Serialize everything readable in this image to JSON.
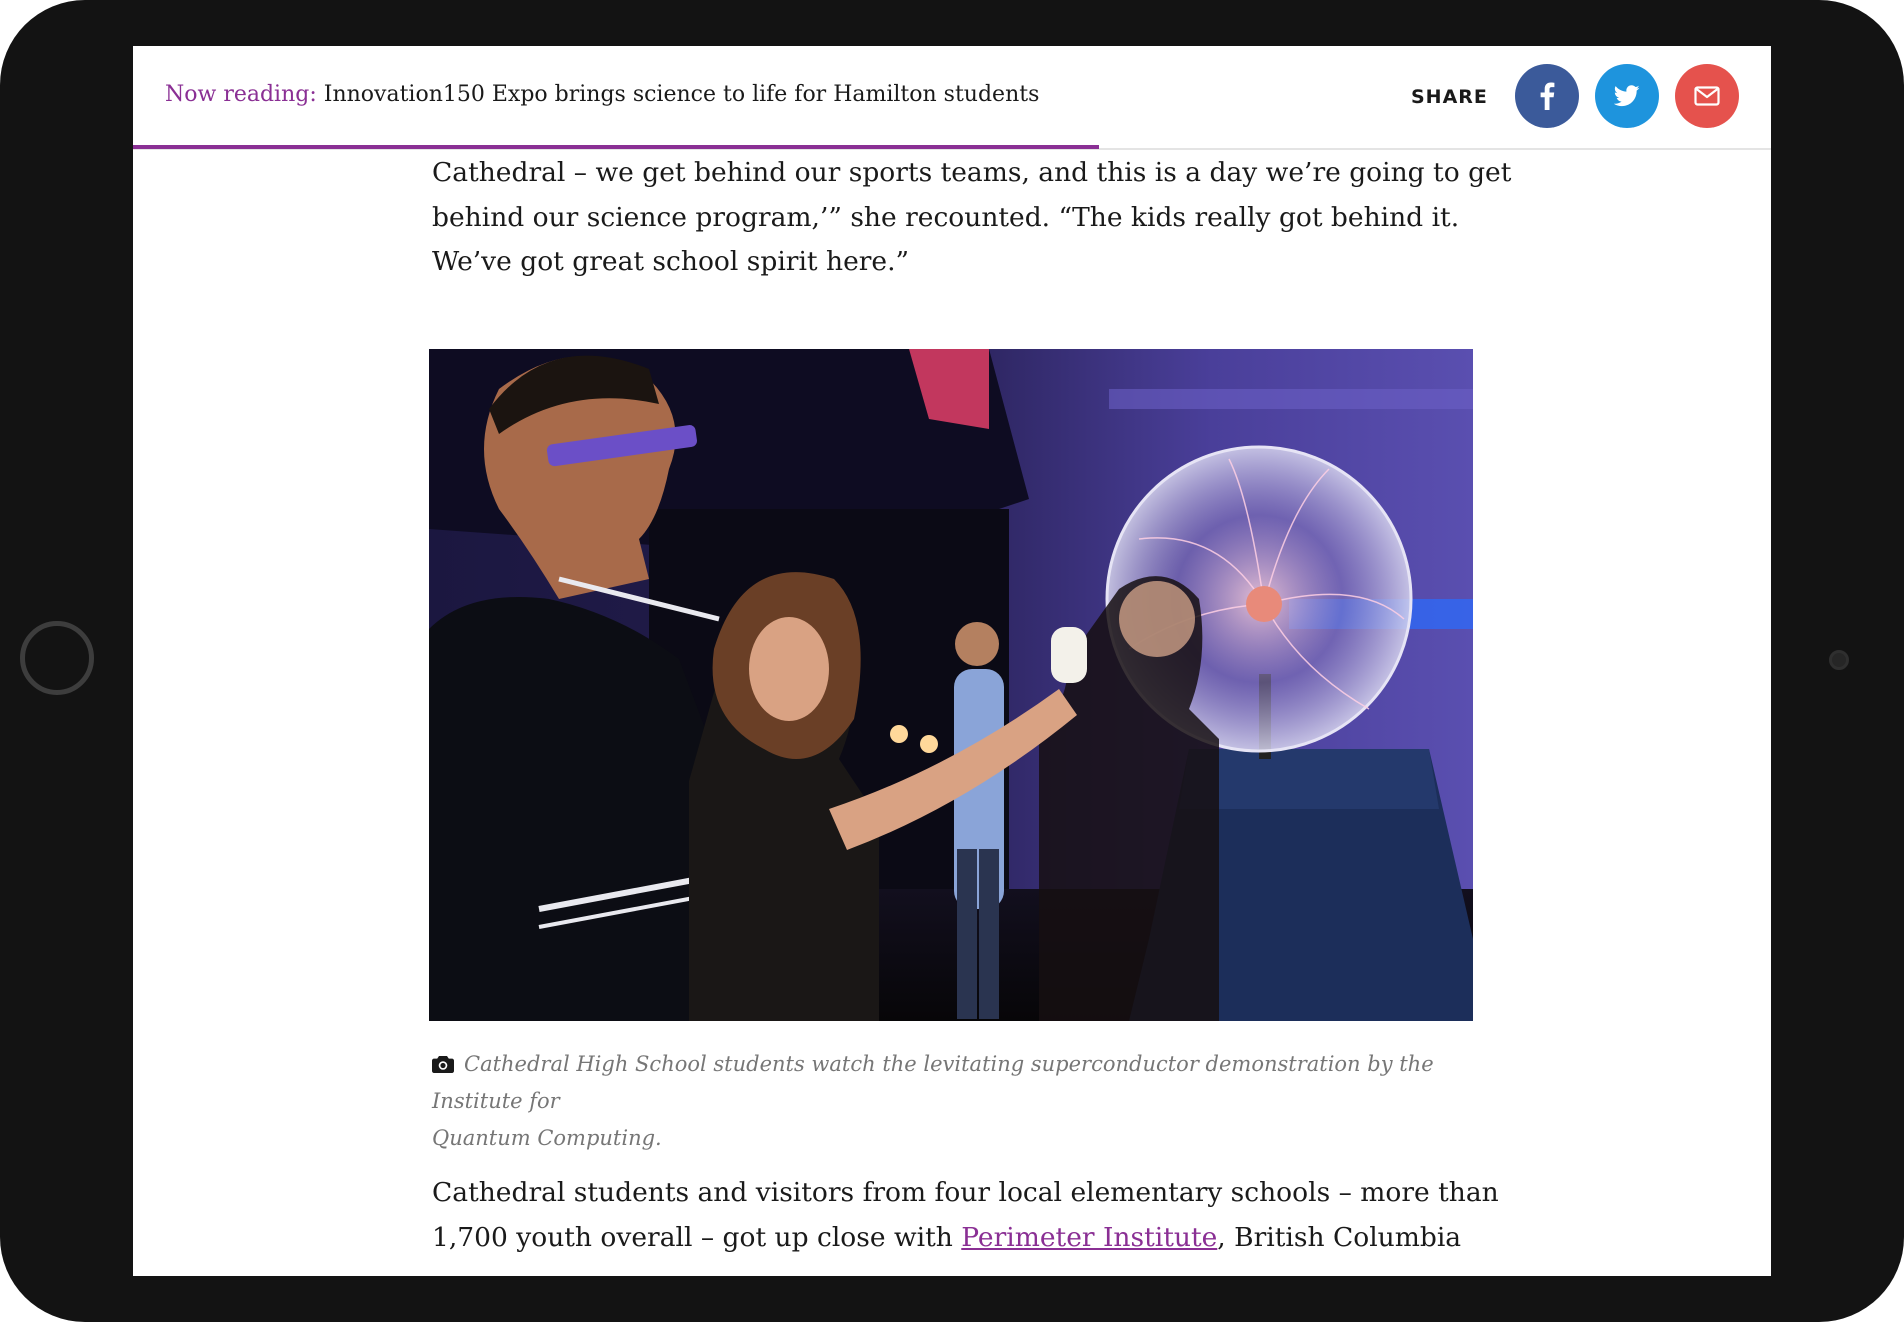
{
  "header": {
    "now_reading_label": "Now reading:",
    "article_title": "Innovation150 Expo brings science to life for Hamilton students",
    "reading_progress": 0.59,
    "share_label": "SHARE",
    "share_buttons": [
      {
        "name": "facebook",
        "icon": "facebook-icon",
        "color": "#3b5a9a"
      },
      {
        "name": "twitter",
        "icon": "twitter-icon",
        "color": "#1e94dd"
      },
      {
        "name": "email",
        "icon": "envelope-icon",
        "color": "#e5524d"
      }
    ]
  },
  "article": {
    "paragraph_1_lines": [
      "Cathedral – we get behind our sports teams, and this is a day we’re going to get",
      "behind our science program,’” she recounted. “The kids really got behind it.",
      "We’ve got great school spirit here.”"
    ],
    "figure": {
      "caption_icon": "camera-icon",
      "caption_lines": [
        "Cathedral High School students watch the levitating superconductor demonstration by the Institute for",
        "Quantum Computing."
      ]
    },
    "paragraph_2": {
      "line_1": "Cathedral students and visitors from four local elementary schools – more than",
      "line_2_before": "1,700 youth overall – got up close with ",
      "line_2_link": "Perimeter Institute",
      "line_2_after": ", British Columbia"
    }
  },
  "colors": {
    "accent": "#8a2f94",
    "text": "#1a1a1a",
    "caption": "#767676"
  }
}
